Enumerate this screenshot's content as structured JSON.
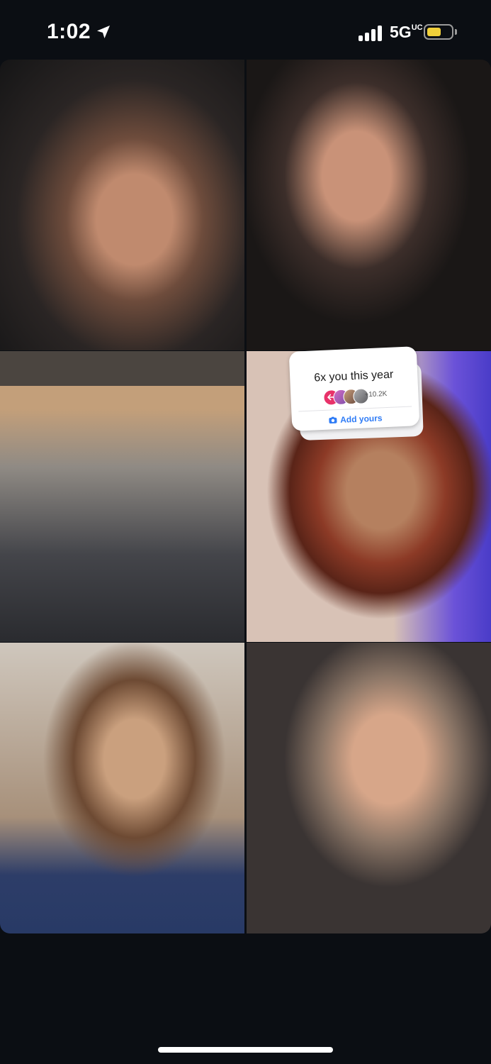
{
  "status_bar": {
    "time": "1:02",
    "location_icon": "location-arrow-icon",
    "signal_icon": "cellular-signal-icon",
    "network": "5G",
    "network_badge": "UC",
    "battery_icon": "battery-icon",
    "battery_level": 0.6,
    "battery_color": "#f1d03a"
  },
  "photo_grid": {
    "tile_count": 6
  },
  "add_yours_sticker": {
    "title": "6x you this year",
    "participants": "+10.2K",
    "button_label": "Add yours",
    "avatar_icon": "reply-arrow-icon",
    "button_icon": "camera-icon",
    "accent_color": "#2f7cf6",
    "badge_color": "#e8326a"
  }
}
